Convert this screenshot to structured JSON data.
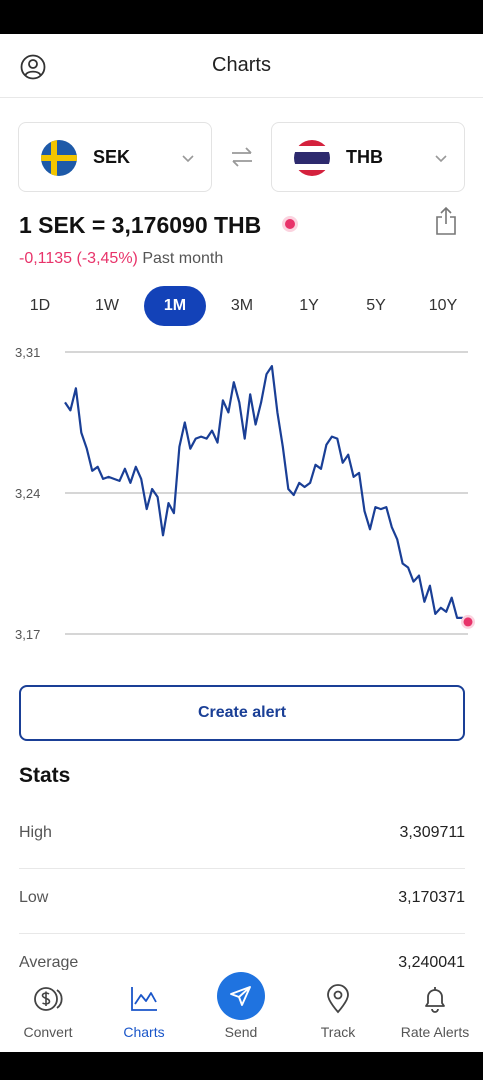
{
  "header": {
    "title": "Charts"
  },
  "from_currency": {
    "code": "SEK",
    "flag": "sweden-flag"
  },
  "to_currency": {
    "code": "THB",
    "flag": "thailand-flag"
  },
  "rate_text": "1 SEK = 3,176090 THB",
  "change": {
    "value": "-0,1135 (-3,45%)",
    "period": "Past month"
  },
  "periods": [
    {
      "label": "1D",
      "active": false
    },
    {
      "label": "1W",
      "active": false
    },
    {
      "label": "1M",
      "active": true
    },
    {
      "label": "3M",
      "active": false
    },
    {
      "label": "1Y",
      "active": false
    },
    {
      "label": "5Y",
      "active": false
    },
    {
      "label": "10Y",
      "active": false
    }
  ],
  "chart_data": {
    "type": "line",
    "ylim": [
      3.17,
      3.31
    ],
    "yticks": [
      "3,31",
      "3,24",
      "3,17"
    ],
    "grid": true,
    "color": "#1a3f96",
    "end_marker_color": "#e8336a",
    "series": [
      {
        "values": [
          3.285,
          3.281,
          3.292,
          3.27,
          3.262,
          3.251,
          3.253,
          3.247,
          3.248,
          3.247,
          3.246,
          3.252,
          3.245,
          3.253,
          3.247,
          3.232,
          3.242,
          3.238,
          3.219,
          3.235,
          3.23,
          3.263,
          3.275,
          3.262,
          3.267,
          3.268,
          3.267,
          3.271,
          3.265,
          3.286,
          3.28,
          3.295,
          3.285,
          3.267,
          3.289,
          3.274,
          3.285,
          3.299,
          3.303,
          3.28,
          3.263,
          3.242,
          3.239,
          3.245,
          3.243,
          3.245,
          3.254,
          3.252,
          3.264,
          3.268,
          3.267,
          3.255,
          3.259,
          3.248,
          3.25,
          3.231,
          3.222,
          3.233,
          3.232,
          3.233,
          3.223,
          3.217,
          3.205,
          3.203,
          3.196,
          3.199,
          3.186,
          3.194,
          3.18,
          3.183,
          3.181,
          3.188,
          3.178,
          3.178,
          3.176
        ]
      }
    ]
  },
  "create_alert_label": "Create alert",
  "stats": {
    "title": "Stats",
    "rows": [
      {
        "label": "High",
        "value": "3,309711"
      },
      {
        "label": "Low",
        "value": "3,170371"
      },
      {
        "label": "Average",
        "value": "3,240041"
      }
    ]
  },
  "nav": [
    {
      "label": "Convert",
      "icon": "dollar-coins-icon"
    },
    {
      "label": "Charts",
      "icon": "line-chart-icon"
    },
    {
      "label": "Send",
      "icon": "send-icon"
    },
    {
      "label": "Track",
      "icon": "location-pin-icon"
    },
    {
      "label": "Rate Alerts",
      "icon": "bell-icon"
    }
  ]
}
